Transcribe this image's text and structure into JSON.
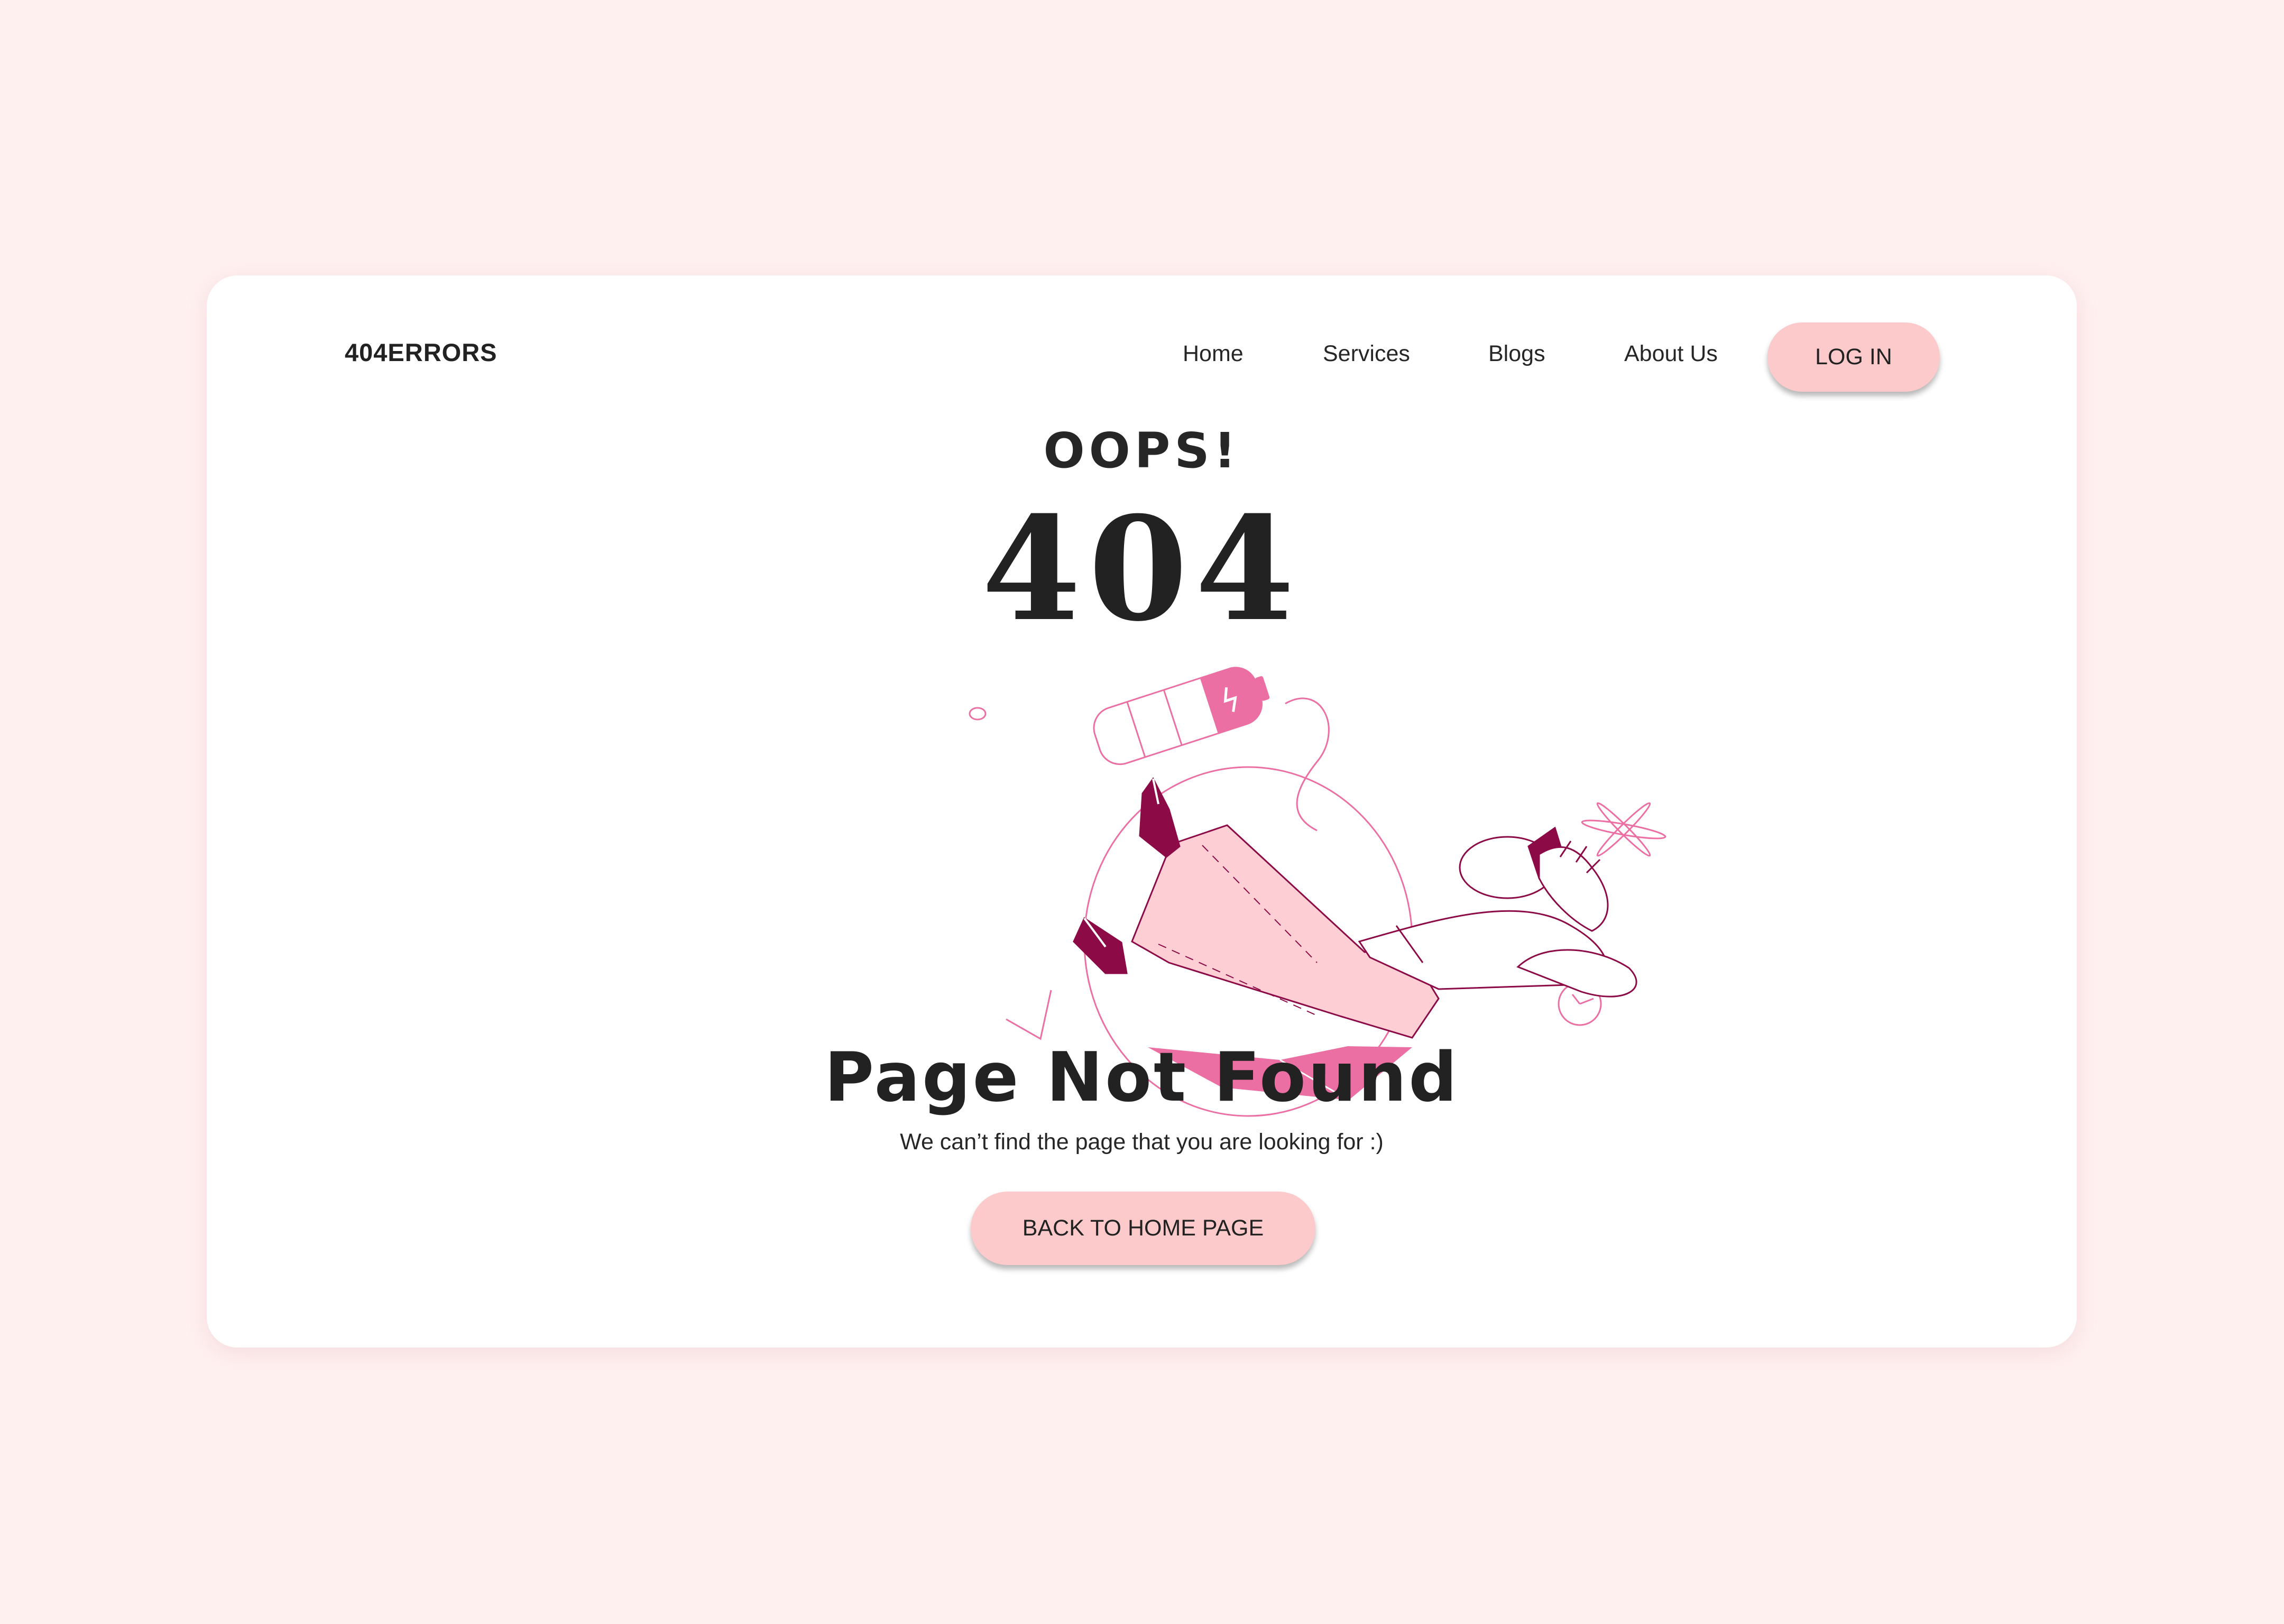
{
  "brand": {
    "logo_text": "404ERRORS"
  },
  "nav": {
    "items": [
      "Home",
      "Services",
      "Blogs",
      "About Us"
    ],
    "login_label": "LOG IN"
  },
  "hero": {
    "oops": "OOPS!",
    "code": "404",
    "title": "Page Not Found",
    "subtitle": "We can’t find the page that you are looking for :)",
    "cta_label": "BACK TO HOME PAGE"
  },
  "colors": {
    "page_background": "#fff0f0",
    "card_background": "#ffffff",
    "button_background": "#fccaca",
    "accent_dark": "#8c0a46",
    "accent_pink": "#ec6fa3",
    "pants_pink": "#fdcfd4",
    "text": "#222222"
  },
  "illustration": {
    "name": "falling-person-illustration"
  }
}
